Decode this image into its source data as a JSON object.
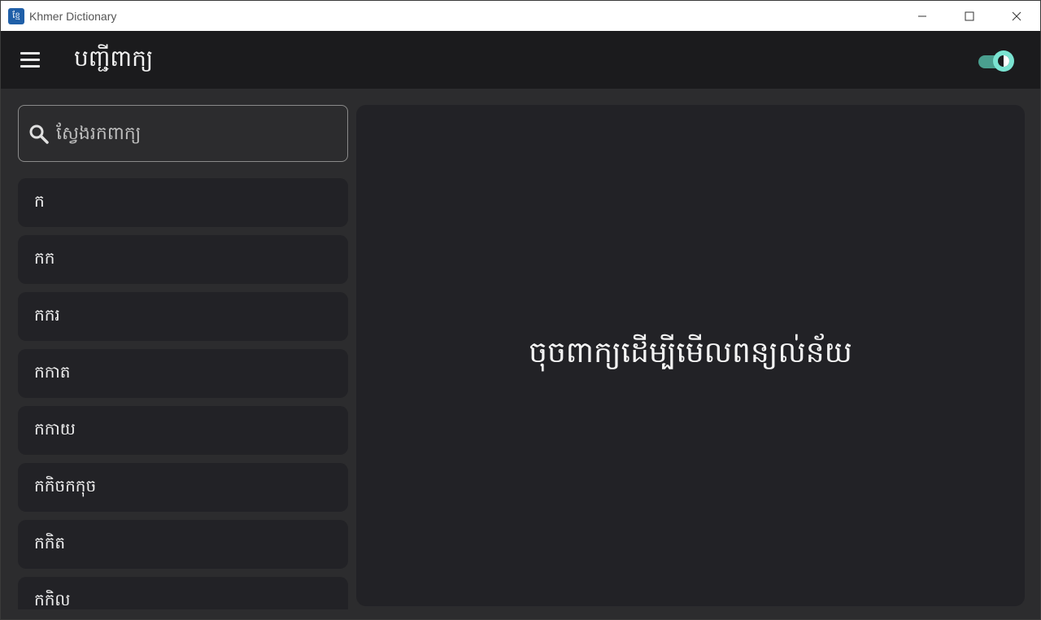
{
  "window": {
    "app_icon_text": "ខ្មែ",
    "title": "Khmer Dictionary",
    "controls": [
      "minimize-icon",
      "maximize-icon",
      "close-icon"
    ]
  },
  "appbar": {
    "menu_icon": "hamburger-menu-icon",
    "title": "បញ្ជីពាក្យ",
    "theme_toggle_on": true,
    "accent_color": "#7ae3d1"
  },
  "search": {
    "icon": "search-icon",
    "placeholder": "ស្វែងរកពាក្យ",
    "value": ""
  },
  "word_list": {
    "items": [
      {
        "label": "ក"
      },
      {
        "label": "កក"
      },
      {
        "label": "កករ"
      },
      {
        "label": "កកាត"
      },
      {
        "label": "កកាយ"
      },
      {
        "label": "កកិចកកុច"
      },
      {
        "label": "កកិត"
      },
      {
        "label": "កកិល"
      }
    ]
  },
  "detail": {
    "placeholder": "ចុចពាក្យដើម្បីមើលពន្យល់ន័យ"
  }
}
